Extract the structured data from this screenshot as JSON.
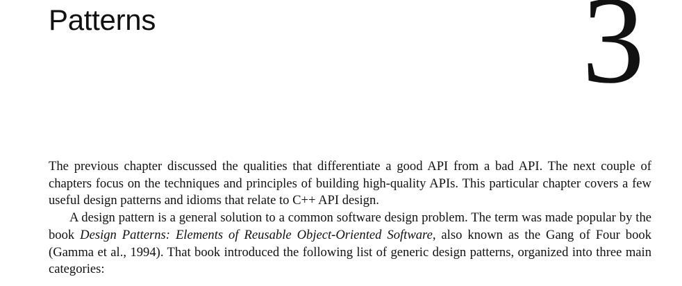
{
  "chapter": {
    "title": "Patterns",
    "number": "3"
  },
  "paragraphs": [
    {
      "text": "The previous chapter discussed the qualities that differentiate a good API from a bad API. The next couple of chapters focus on the techniques and principles of building high-quality APIs. This particular chapter covers a few useful design patterns and idioms that relate to C++ API design."
    },
    {
      "before": "A design pattern is a general solution to a common software design problem. The term was made popular by the book ",
      "book_title": "Design Patterns: Elements of Reusable Object-Oriented Software",
      "after": ", also known as the Gang of Four book (Gamma et al., 1994). That book introduced the following list of generic design patterns, organized into three main categories:"
    }
  ]
}
